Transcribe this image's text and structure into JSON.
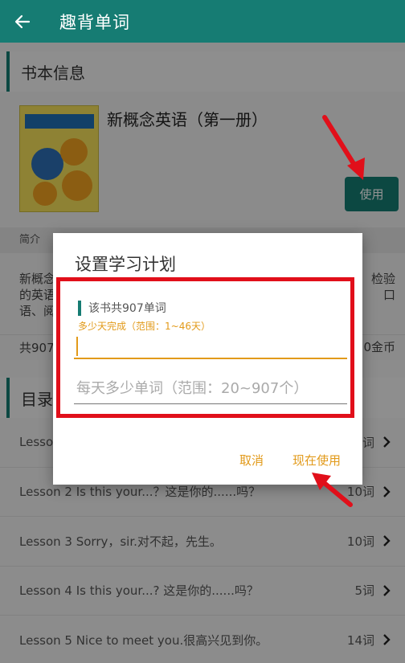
{
  "appbar": {
    "title": "趣背单词",
    "back_icon": "arrow-left-icon"
  },
  "book_section": {
    "header": "书本信息"
  },
  "book": {
    "title": "新概念英语（第一册）",
    "use_button": "使用",
    "cover_icon": "book-cover-image"
  },
  "intro": {
    "header": "简介",
    "left_lines": [
      "新概念",
      "的英语",
      "语、阅"
    ],
    "right_lines": [
      "检验",
      "口"
    ]
  },
  "stats": {
    "left": "共907",
    "right": "0金币"
  },
  "catalog": {
    "header": "目录"
  },
  "lessons": [
    {
      "name": "Lesson",
      "count": "词"
    },
    {
      "name": "Lesson 2 Is this your...？这是你的......吗？",
      "count": "10词"
    },
    {
      "name": "Lesson 3 Sorry，sir.对不起，先生。",
      "count": "10词"
    },
    {
      "name": "Lesson 4 Is this your...? 这是你的......吗？",
      "count": "5词"
    },
    {
      "name": "Lesson 5 Nice to meet you.很高兴见到你。",
      "count": "14词"
    }
  ],
  "dialog": {
    "title": "设置学习计划",
    "word_count": "该书共907单词",
    "days_label": "多少天完成（范围：1~46天）",
    "days_value": "",
    "per_day_placeholder": "每天多少单词（范围：20~907个）",
    "cancel": "取消",
    "confirm": "现在使用"
  },
  "colors": {
    "primary": "#167c73",
    "accent": "#e29a1a",
    "highlight": "#e10f1a"
  }
}
